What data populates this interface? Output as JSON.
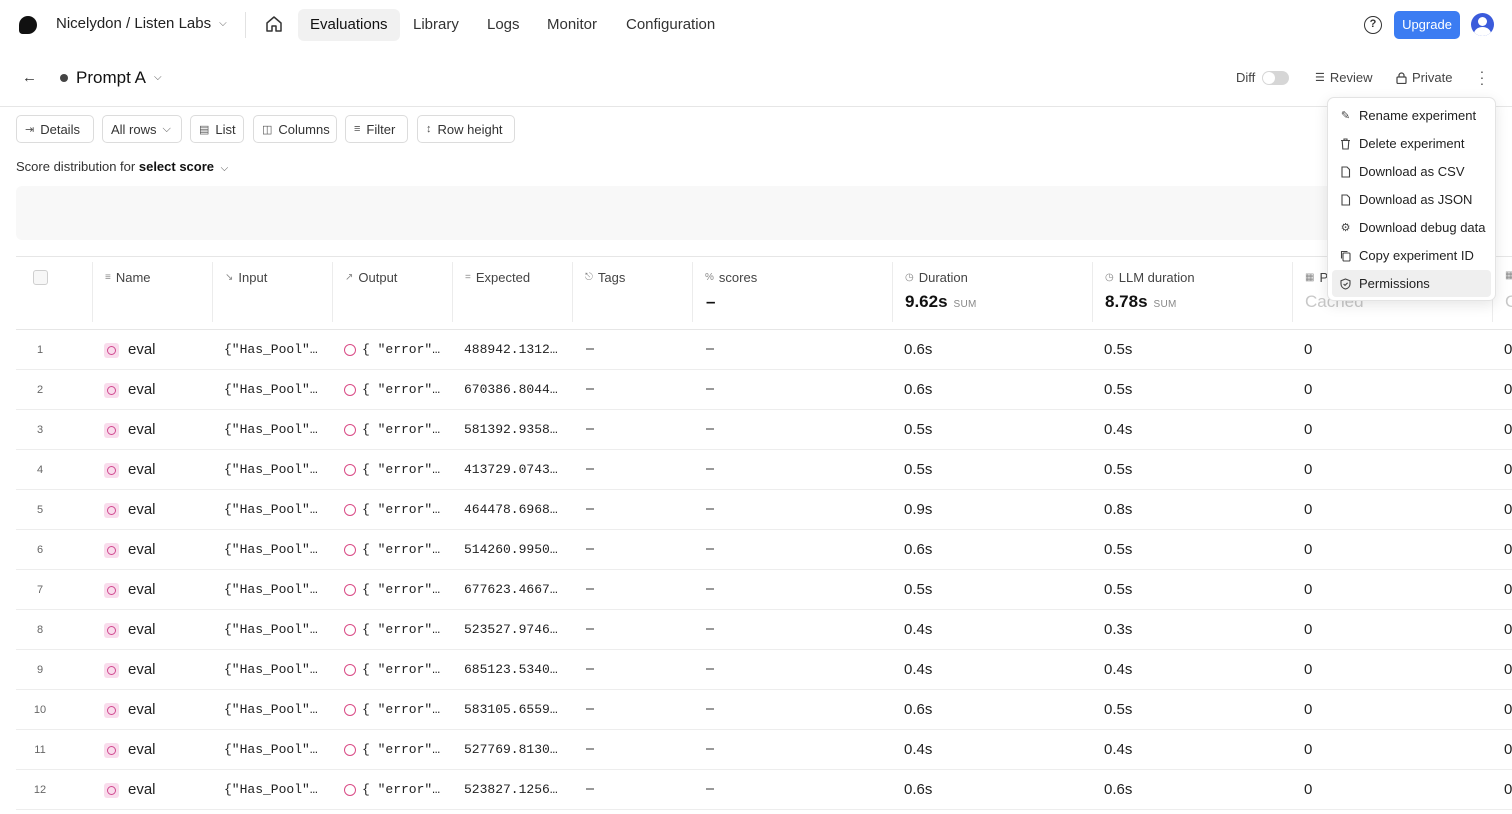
{
  "nav": {
    "org": "Nicelydon / Listen Labs",
    "tabs": [
      "Evaluations",
      "Library",
      "Logs",
      "Monitor",
      "Configuration"
    ],
    "help": "?",
    "upgrade": "Upgrade"
  },
  "experiment": {
    "title": "Prompt A",
    "diff_label": "Diff",
    "diff_enabled": false,
    "review": "Review",
    "privacy": "Private"
  },
  "toolbar": {
    "details": "Details",
    "rows_filter": "All rows",
    "list": "List",
    "columns": "Columns",
    "filter": "Filter",
    "row_height": "Row height"
  },
  "score_distribution": {
    "prefix": "Score distribution for",
    "selected": "select score"
  },
  "table": {
    "columns": {
      "name": "Name",
      "input": "Input",
      "output": "Output",
      "expected": "Expected",
      "tags": "Tags",
      "scores": "scores",
      "duration": "Duration",
      "llm_duration": "LLM duration",
      "partial_col": "P"
    },
    "aggregates": {
      "scores": "–",
      "duration_value": "9.62s",
      "duration_label": "SUM",
      "llm_value": "8.78s",
      "llm_label": "SUM",
      "cached": "Cached"
    },
    "rows": [
      {
        "n": "1",
        "name": "eval",
        "input": "{\"Has_Pool\"…",
        "output": "{ \"error\"…",
        "expected": "488942.1312…",
        "tags": "–",
        "scores": "–",
        "duration": "0.6s",
        "llm": "0.5s",
        "p": "0",
        "q": "0"
      },
      {
        "n": "2",
        "name": "eval",
        "input": "{\"Has_Pool\"…",
        "output": "{ \"error\"…",
        "expected": "670386.8044…",
        "tags": "–",
        "scores": "–",
        "duration": "0.6s",
        "llm": "0.5s",
        "p": "0",
        "q": "0"
      },
      {
        "n": "3",
        "name": "eval",
        "input": "{\"Has_Pool\"…",
        "output": "{ \"error\"…",
        "expected": "581392.9358…",
        "tags": "–",
        "scores": "–",
        "duration": "0.5s",
        "llm": "0.4s",
        "p": "0",
        "q": "0"
      },
      {
        "n": "4",
        "name": "eval",
        "input": "{\"Has_Pool\"…",
        "output": "{ \"error\"…",
        "expected": "413729.0743…",
        "tags": "–",
        "scores": "–",
        "duration": "0.5s",
        "llm": "0.5s",
        "p": "0",
        "q": "0"
      },
      {
        "n": "5",
        "name": "eval",
        "input": "{\"Has_Pool\"…",
        "output": "{ \"error\"…",
        "expected": "464478.6968…",
        "tags": "–",
        "scores": "–",
        "duration": "0.9s",
        "llm": "0.8s",
        "p": "0",
        "q": "0"
      },
      {
        "n": "6",
        "name": "eval",
        "input": "{\"Has_Pool\"…",
        "output": "{ \"error\"…",
        "expected": "514260.9950…",
        "tags": "–",
        "scores": "–",
        "duration": "0.6s",
        "llm": "0.5s",
        "p": "0",
        "q": "0"
      },
      {
        "n": "7",
        "name": "eval",
        "input": "{\"Has_Pool\"…",
        "output": "{ \"error\"…",
        "expected": "677623.4667…",
        "tags": "–",
        "scores": "–",
        "duration": "0.5s",
        "llm": "0.5s",
        "p": "0",
        "q": "0"
      },
      {
        "n": "8",
        "name": "eval",
        "input": "{\"Has_Pool\"…",
        "output": "{ \"error\"…",
        "expected": "523527.9746…",
        "tags": "–",
        "scores": "–",
        "duration": "0.4s",
        "llm": "0.3s",
        "p": "0",
        "q": "0"
      },
      {
        "n": "9",
        "name": "eval",
        "input": "{\"Has_Pool\"…",
        "output": "{ \"error\"…",
        "expected": "685123.5340…",
        "tags": "–",
        "scores": "–",
        "duration": "0.4s",
        "llm": "0.4s",
        "p": "0",
        "q": "0"
      },
      {
        "n": "10",
        "name": "eval",
        "input": "{\"Has_Pool\"…",
        "output": "{ \"error\"…",
        "expected": "583105.6559…",
        "tags": "–",
        "scores": "–",
        "duration": "0.6s",
        "llm": "0.5s",
        "p": "0",
        "q": "0"
      },
      {
        "n": "11",
        "name": "eval",
        "input": "{\"Has_Pool\"…",
        "output": "{ \"error\"…",
        "expected": "527769.8130…",
        "tags": "–",
        "scores": "–",
        "duration": "0.4s",
        "llm": "0.4s",
        "p": "0",
        "q": "0"
      },
      {
        "n": "12",
        "name": "eval",
        "input": "{\"Has_Pool\"…",
        "output": "{ \"error\"…",
        "expected": "523827.1256…",
        "tags": "–",
        "scores": "–",
        "duration": "0.6s",
        "llm": "0.6s",
        "p": "0",
        "q": "0"
      }
    ]
  },
  "menu": {
    "items": [
      {
        "label": "Rename experiment",
        "icon": "pencil-icon"
      },
      {
        "label": "Delete experiment",
        "icon": "trash-icon"
      },
      {
        "label": "Download as CSV",
        "icon": "file-icon"
      },
      {
        "label": "Download as JSON",
        "icon": "file-icon"
      },
      {
        "label": "Download debug data",
        "icon": "bug-icon"
      },
      {
        "label": "Copy experiment ID",
        "icon": "copy-icon"
      },
      {
        "label": "Permissions",
        "icon": "shield-icon"
      }
    ],
    "highlighted": "Permissions"
  },
  "colors": {
    "accent": "#3b7cf2",
    "error": "#d94b86",
    "eval_badge": "#f9dcec"
  }
}
